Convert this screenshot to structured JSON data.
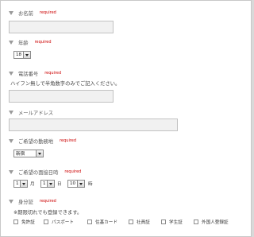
{
  "fields": {
    "name": {
      "label": "お名前",
      "required": "required"
    },
    "age": {
      "label": "年齢",
      "required": "required",
      "selected": "18"
    },
    "phone": {
      "label": "電話番号",
      "required": "required",
      "note": "ハイフン無しで半角数字のみでご記入ください。"
    },
    "email": {
      "label": "メールアドレス"
    },
    "location": {
      "label": "ご希望の勤務地",
      "required": "required",
      "selected": "新宿"
    },
    "interview": {
      "label": "ご希望の面接日時",
      "required": "required",
      "month": "1",
      "month_unit": "月",
      "day": "1",
      "day_unit": "日",
      "hour": "10",
      "hour_unit": "時"
    },
    "id_card": {
      "label": "身分証",
      "required": "required",
      "note": "※期限切れでも登録できます。",
      "options": [
        "免許証",
        "パスポート",
        "住基カード",
        "社員証",
        "学生証",
        "外国人登録証"
      ]
    }
  }
}
